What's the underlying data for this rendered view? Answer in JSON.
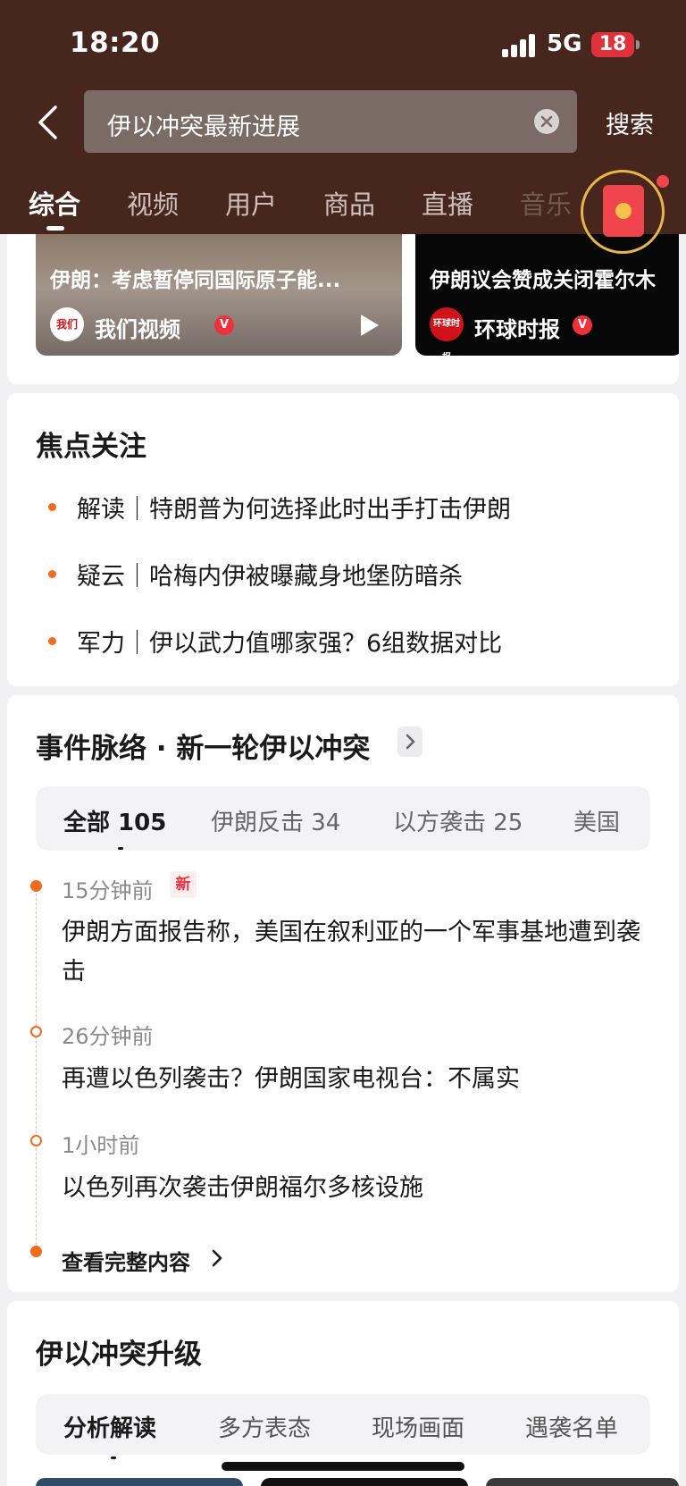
{
  "status_bar": {
    "time": "18:20",
    "network": "5G",
    "battery": "18",
    "icons": [
      "signal-icon",
      "battery-icon"
    ]
  },
  "search": {
    "back_icon": "chevron-left-icon",
    "query": "伊以冲突最新进展",
    "clear_icon": "close-circle-icon",
    "submit_label": "搜索"
  },
  "tabs": [
    "综合",
    "视频",
    "用户",
    "商品",
    "直播",
    "音乐"
  ],
  "active_tab": "综合",
  "floating": {
    "icon": "red-packet-icon"
  },
  "videos": [
    {
      "title": "伊朗：考虑暂停同国际原子能...",
      "author": "我们视频",
      "logo_text": "我们",
      "verified": "V"
    },
    {
      "title": "伊朗议会赞成关闭霍尔木",
      "author": "环球时报",
      "logo_text": "环球时报",
      "verified": "V"
    }
  ],
  "focus": {
    "title": "焦点关注",
    "items": [
      "解读｜特朗普为何选择此时出手打击伊朗",
      "疑云｜哈梅内伊被曝藏身地堡防暗杀",
      "军力｜伊以武力值哪家强？6组数据对比"
    ]
  },
  "timeline": {
    "title": "事件脉络 · 新一轮伊以冲突",
    "filters": [
      "全部 105",
      "伊朗反击 34",
      "以方袭击 25",
      "美国"
    ],
    "entries": [
      {
        "time": "15分钟前",
        "badge": "新",
        "text": "伊朗方面报告称，美国在叙利亚的一个军事基地遭到袭击"
      },
      {
        "time": "26分钟前",
        "text": "再遭以色列袭击？伊朗国家电视台：不属实"
      },
      {
        "time": "1小时前",
        "text": "以色列再次袭击伊朗福尔多核设施"
      }
    ],
    "view_more": "查看完整内容"
  },
  "upgrade": {
    "title": "伊以冲突升级",
    "tabs": [
      "分析解读",
      "多方表态",
      "现场画面",
      "遇袭名单"
    ]
  },
  "colors": {
    "header_bg": "#46261d",
    "accent_orange": "#f26a1b",
    "verified_red": "#f0303a"
  }
}
